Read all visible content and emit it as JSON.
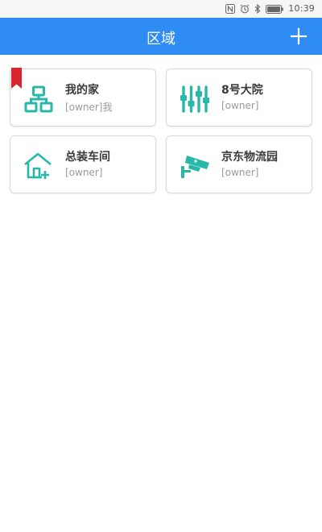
{
  "status_bar": {
    "time": "10:39",
    "icons": [
      "nfc-icon",
      "alarm-icon",
      "bluetooth-icon",
      "battery-icon"
    ]
  },
  "app_bar": {
    "title": "区域",
    "add_icon": "plus-icon"
  },
  "areas": [
    {
      "name": "我的家",
      "owner": "[owner]我",
      "icon": "network-icon",
      "marked": true
    },
    {
      "name": "8号大院",
      "owner": "[owner]",
      "icon": "sliders-icon",
      "marked": false
    },
    {
      "name": "总装车间",
      "owner": "[owner]",
      "icon": "house-add-icon",
      "marked": false
    },
    {
      "name": "京东物流园",
      "owner": "[owner]",
      "icon": "camera-icon",
      "marked": false
    }
  ],
  "colors": {
    "accent": "#2f8cf4",
    "icon_teal": "#28b8aa",
    "ribbon_red": "#d8262e",
    "owner_gray": "#9a9a9a",
    "name_dark": "#3a3a3a"
  }
}
